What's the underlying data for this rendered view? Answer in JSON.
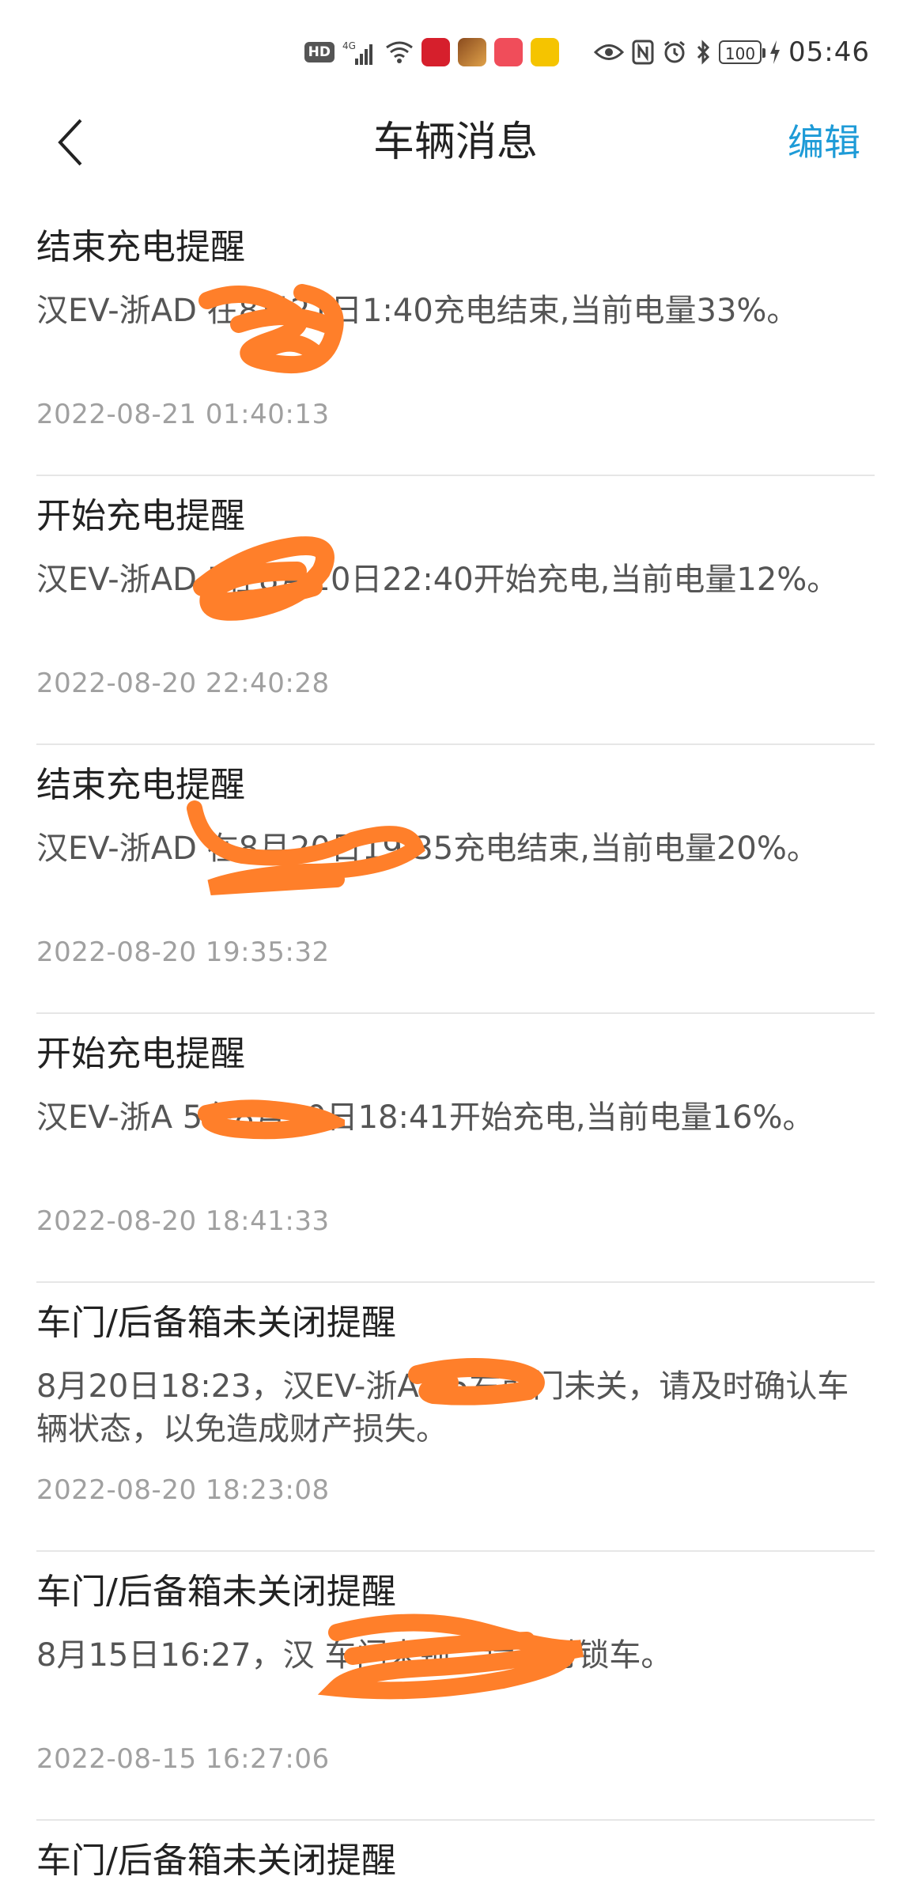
{
  "status_bar": {
    "hd": "HD",
    "signal": "4G",
    "battery": "100",
    "time": "05:46"
  },
  "header": {
    "title": "车辆消息",
    "edit": "编辑"
  },
  "messages": [
    {
      "title": "结束充电提醒",
      "body": "汉EV-浙AD     在8月21日1:40充电结束,当前电量33%。",
      "time": "2022-08-21 01:40:13"
    },
    {
      "title": "开始充电提醒",
      "body": "汉EV-浙AD     5在8月20日22:40开始充电,当前电量12%。",
      "time": "2022-08-20 22:40:28"
    },
    {
      "title": "结束充电提醒",
      "body": "汉EV-浙AD      在8月20日19:35充电结束,当前电量20%。",
      "time": "2022-08-20 19:35:32"
    },
    {
      "title": "开始充电提醒",
      "body": "汉EV-浙A     5在8月20日18:41开始充电,当前电量16%。",
      "time": "2022-08-20 18:41:33"
    },
    {
      "title": "车门/后备箱未关闭提醒",
      "body": "8月20日18:23，汉EV-浙A     05右前门未关，请及时确认车辆状态，以免造成财产损失。",
      "time": "2022-08-20 18:23:08"
    },
    {
      "title": "车门/后备箱未关闭提醒",
      "body": "8月15日16:27，汉           车门未锁，请及时锁车。",
      "time": "2022-08-15 16:27:06"
    },
    {
      "title": "车门/后备箱未关闭提醒",
      "body": "",
      "time": ""
    }
  ],
  "colors": {
    "accent": "#1e9bd7",
    "redaction": "#ff7f2a"
  }
}
